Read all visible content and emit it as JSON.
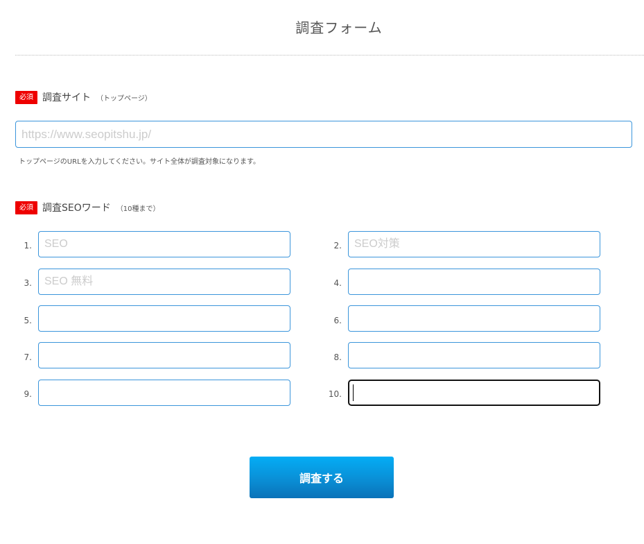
{
  "header": {
    "title": "調査フォーム"
  },
  "site_field": {
    "required_badge": "必須",
    "label": "調査サイト",
    "sub_label": "（トップページ）",
    "placeholder": "https://www.seopitshu.jp/",
    "value": "",
    "help_text": "トップページのURLを入力してください。サイト全体が調査対象になります。"
  },
  "keywords_field": {
    "required_badge": "必須",
    "label": "調査SEOワード",
    "sub_label": "（10種まで）",
    "items": [
      {
        "number": "1.",
        "placeholder": "SEO",
        "value": ""
      },
      {
        "number": "2.",
        "placeholder": "SEO対策",
        "value": ""
      },
      {
        "number": "3.",
        "placeholder": "SEO 無料",
        "value": ""
      },
      {
        "number": "4.",
        "placeholder": "",
        "value": ""
      },
      {
        "number": "5.",
        "placeholder": "",
        "value": ""
      },
      {
        "number": "6.",
        "placeholder": "",
        "value": ""
      },
      {
        "number": "7.",
        "placeholder": "",
        "value": ""
      },
      {
        "number": "8.",
        "placeholder": "",
        "value": ""
      },
      {
        "number": "9.",
        "placeholder": "",
        "value": ""
      },
      {
        "number": "10.",
        "placeholder": "",
        "value": ""
      }
    ],
    "focused_item": "10."
  },
  "submit": {
    "label": "調査する"
  },
  "colors": {
    "required_badge": "#ee0000",
    "input_border": "#3a95db",
    "focused_border": "#111111",
    "button_top": "#04adf5",
    "button_bottom": "#0a72b8"
  }
}
